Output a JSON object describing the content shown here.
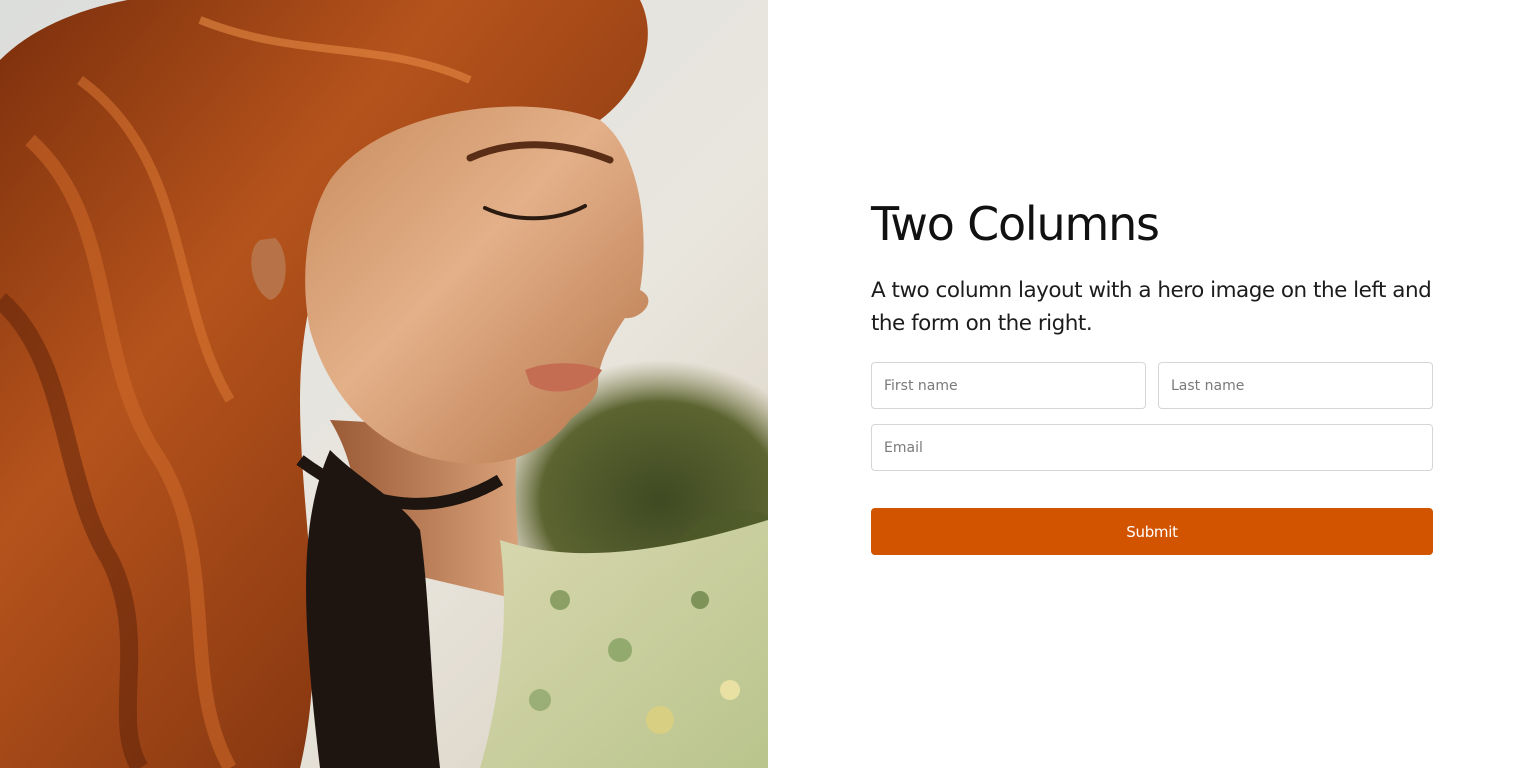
{
  "hero": {
    "image_description_icon": "portrait-photo-icon"
  },
  "main": {
    "title": "Two Columns",
    "subtitle": "A two column layout with a hero image on the left and the form on the right."
  },
  "form": {
    "first_name_placeholder": "First name",
    "last_name_placeholder": "Last name",
    "email_placeholder": "Email",
    "submit_label": "Submit"
  },
  "colors": {
    "accent": "#d35400",
    "text": "#111111",
    "border": "#d6d6d6"
  }
}
